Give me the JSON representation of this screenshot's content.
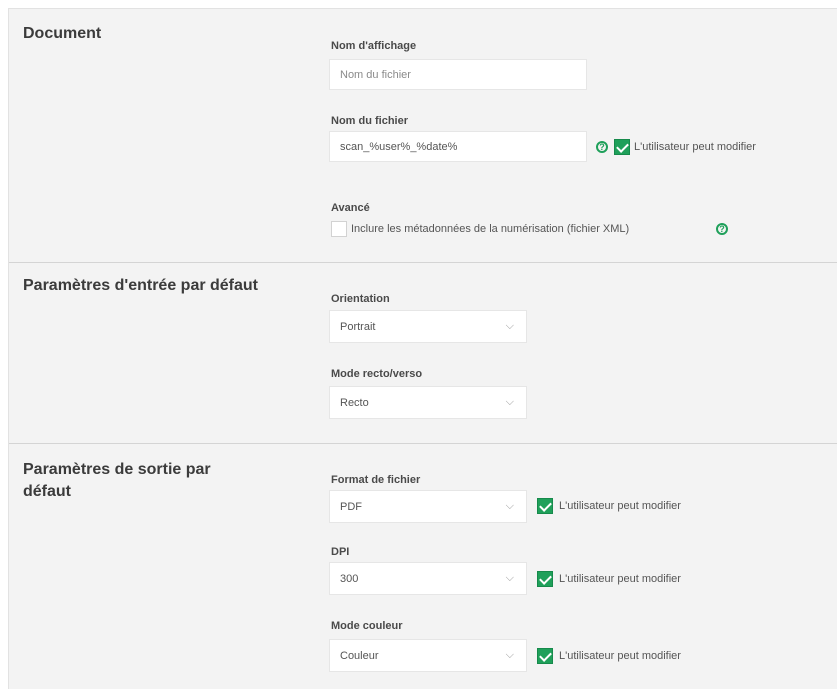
{
  "document": {
    "title": "Document",
    "display_name": {
      "label": "Nom d'affichage",
      "placeholder": "Nom du fichier",
      "value": ""
    },
    "file_name": {
      "label": "Nom du fichier",
      "value": "scan_%user%_%date%",
      "user_can_modify_label": "L'utilisateur peut modifier",
      "user_can_modify": true
    },
    "advanced": {
      "label": "Avancé",
      "metadata_label": "Inclure les métadonnées de la numérisation (fichier XML)",
      "metadata_checked": false
    }
  },
  "input_defaults": {
    "title": "Paramètres d'entrée par défaut",
    "orientation": {
      "label": "Orientation",
      "value": "Portrait"
    },
    "duplex": {
      "label": "Mode recto/verso",
      "value": "Recto"
    }
  },
  "output_defaults": {
    "title": "Paramètres de sortie par défaut",
    "file_format": {
      "label": "Format de fichier",
      "value": "PDF",
      "user_can_modify_label": "L'utilisateur peut modifier",
      "user_can_modify": true
    },
    "dpi": {
      "label": "DPI",
      "value": "300",
      "user_can_modify_label": "L'utilisateur peut modifier",
      "user_can_modify": true
    },
    "color_mode": {
      "label": "Mode couleur",
      "value": "Couleur",
      "user_can_modify_label": "L'utilisateur peut modifier",
      "user_can_modify": true
    }
  },
  "icons": {
    "help": "help-circle-icon",
    "dropdown": "chevron-down-icon",
    "check": "check-icon"
  },
  "colors": {
    "accent": "#1fa05a",
    "panel_bg": "#f3f3f3"
  }
}
